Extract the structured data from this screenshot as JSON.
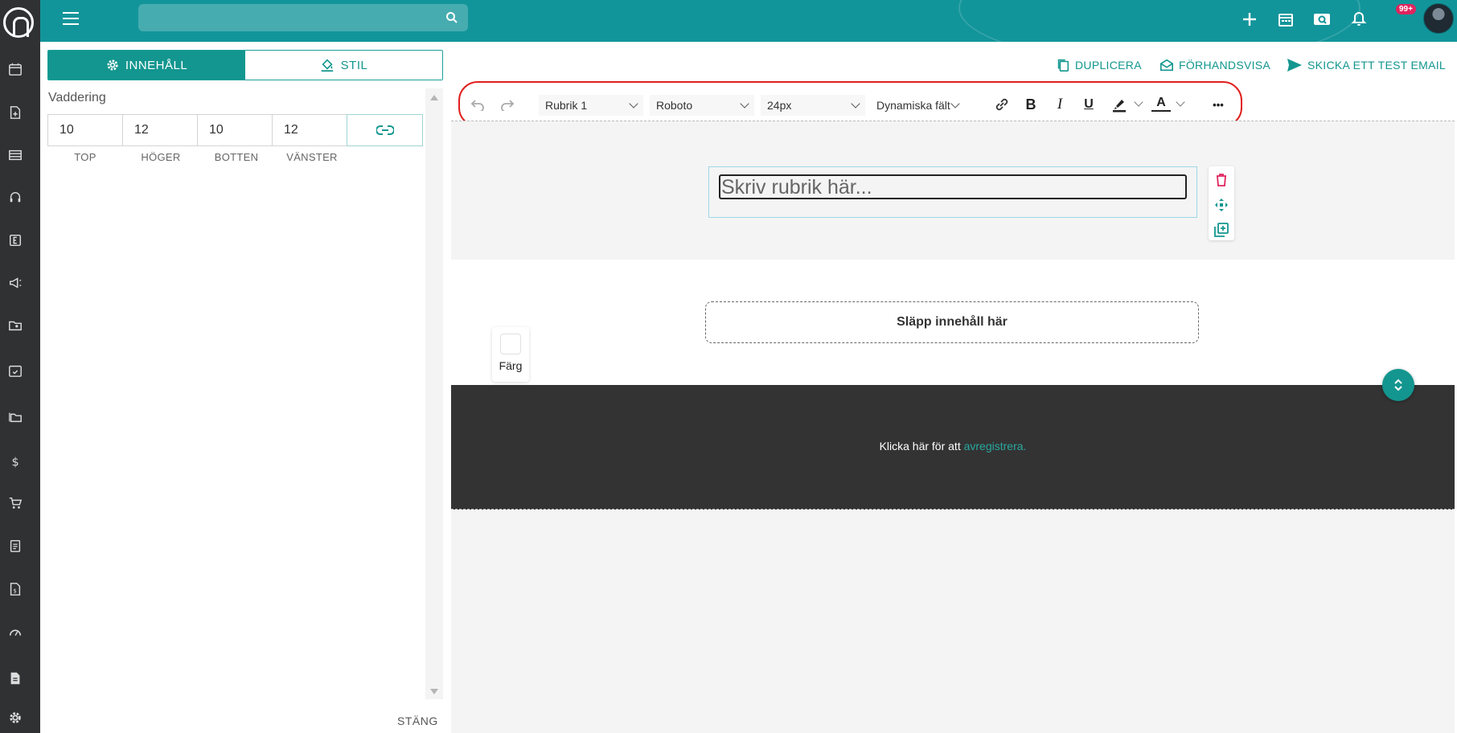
{
  "topbar": {
    "search_placeholder": "",
    "notification_badge": "99+",
    "help_label": "?"
  },
  "panel": {
    "tabs": [
      {
        "label": "INNEHÅLL",
        "active": true
      },
      {
        "label": "STIL",
        "active": false
      }
    ],
    "section_label": "Vaddering",
    "padding": {
      "values": [
        "10",
        "12",
        "10",
        "12"
      ],
      "labels": [
        "TOP",
        "HÖGER",
        "BOTTEN",
        "VÄNSTER"
      ]
    },
    "close_label": "STÄNG"
  },
  "actions": {
    "duplicate": "DUPLICERA",
    "preview": "FÖRHANDSVISA",
    "send_test": "SKICKA ETT TEST EMAIL"
  },
  "toolbar": {
    "block_style": "Rubrik 1",
    "font": "Roboto",
    "font_size": "24px",
    "dynamic_fields": "Dynamiska fält",
    "bold": "B",
    "italic": "I",
    "underline": "U",
    "text_color": "A",
    "more": "•••",
    "highlight_color": "#e0201e"
  },
  "canvas": {
    "heading_placeholder": "Skriv rubrik här...",
    "drop_zone": "Släpp innehåll här",
    "color_label": "Färg",
    "footer_prefix": "Klicka här för att ",
    "footer_link": "avregistrera."
  },
  "colors": {
    "brand": "#12959a",
    "rail": "#2f3133",
    "delete": "#e0245e",
    "footer_bg": "#333333"
  }
}
